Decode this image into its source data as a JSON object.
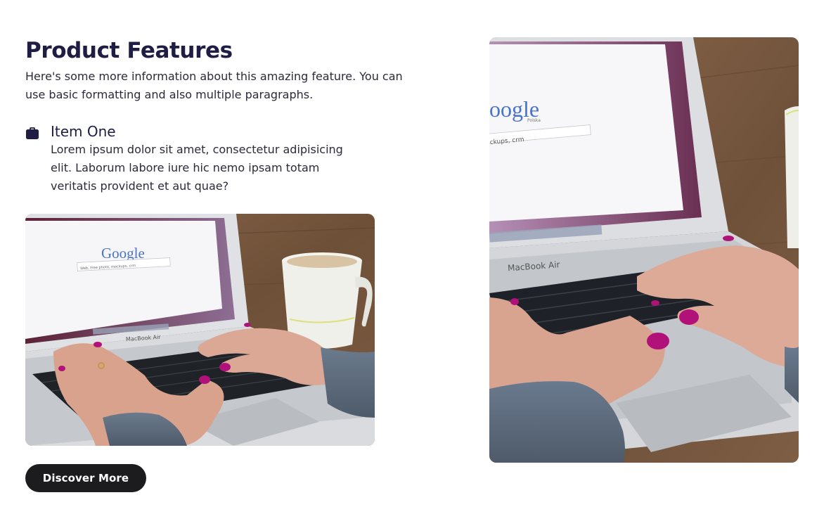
{
  "section": {
    "title": "Product Features",
    "intro": "Here's some more information about this amazing feature. You can use basic formatting and also multiple paragraphs.",
    "feature": {
      "icon": "briefcase-icon",
      "title": "Item One",
      "text": "Lorem ipsum dolor sit amet, consectetur adipisicing elit. Laborum labore iure hic nemo ipsam totam veritatis provident et aut quae?"
    },
    "button_label": "Discover More"
  },
  "images": {
    "small": {
      "google_logo": "Google",
      "search_text": "Web, Free photo, mockups, crm",
      "laptop_brand": "MacBook Air"
    },
    "large": {
      "google_logo": "oogle",
      "logo_sub": "Polska",
      "search_text": "ckups, crm",
      "laptop_brand": "MacBook Air"
    }
  },
  "colors": {
    "heading": "#1f1d43",
    "button_bg": "#1c1c1e",
    "button_text": "#ffffff"
  }
}
